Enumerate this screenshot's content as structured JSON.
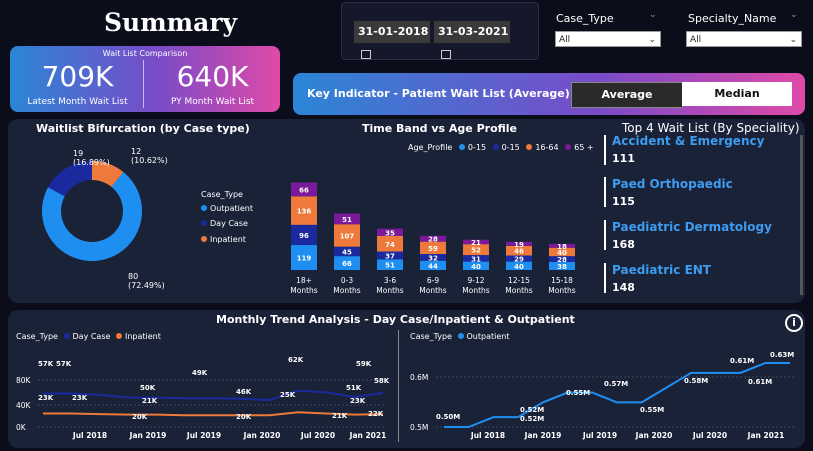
{
  "header": {
    "title": "Summary"
  },
  "dates": {
    "start": "31-01-2018",
    "end": "31-03-2021"
  },
  "slicers": [
    {
      "label": "Case_Type",
      "value": "All"
    },
    {
      "label": "Specialty_Name",
      "value": "All"
    }
  ],
  "wait_card": {
    "title": "Wait List Comparison",
    "latest_value": "709K",
    "latest_label": "Latest Month Wait List",
    "py_value": "640K",
    "py_label": "PY Month Wait List"
  },
  "key_indicator": {
    "label": "Key Indicator - Patient Wait List (Average)",
    "average": "Average",
    "median": "Median"
  },
  "bifurcation": {
    "title": "Waitlist Bifurcation (by Case type)",
    "legend_title": "Case_Type",
    "legend": [
      {
        "name": "Outpatient",
        "color": "#1e8ff0"
      },
      {
        "name": "Day Case",
        "color": "#1a2a9e"
      },
      {
        "name": "Inpatient",
        "color": "#ed7a3a"
      }
    ],
    "labels": [
      {
        "value": "19",
        "pct": "(16.89%)"
      },
      {
        "value": "12",
        "pct": "(10.62%)"
      },
      {
        "value": "80",
        "pct": "(72.49%)"
      }
    ]
  },
  "timeband": {
    "title": "Time Band vs Age Profile",
    "legend_title": "Age_Profile"
  },
  "chart_data": [
    {
      "type": "pie",
      "title": "Waitlist Bifurcation (by Case type)",
      "categories": [
        "Outpatient",
        "Day Case",
        "Inpatient"
      ],
      "values": [
        80,
        19,
        12
      ],
      "percent": [
        72.49,
        16.89,
        10.62
      ],
      "colors": [
        "#1e8ff0",
        "#1a2a9e",
        "#ed7a3a"
      ]
    },
    {
      "type": "bar",
      "stacked": true,
      "title": "Time Band vs Age Profile",
      "legend_title": "Age_Profile",
      "categories": [
        "18+ Months",
        "0-3 Months",
        "3-6 Months",
        "6-9 Months",
        "9-12 Months",
        "12-15 Months",
        "15-18 Months"
      ],
      "series": [
        {
          "name": "0-15",
          "color": "#1e8ff0",
          "values": [
            119,
            66,
            51,
            44,
            40,
            40,
            38
          ]
        },
        {
          "name": "0-15",
          "color": "#1a2a9e",
          "values": [
            96,
            45,
            37,
            32,
            31,
            29,
            28
          ]
        },
        {
          "name": "16-64",
          "color": "#ed7a3a",
          "values": [
            136,
            107,
            74,
            59,
            52,
            46,
            40
          ]
        },
        {
          "name": "65 +",
          "color": "#7a1a9a",
          "values": [
            66,
            51,
            35,
            28,
            21,
            19,
            18
          ]
        }
      ]
    },
    {
      "type": "line",
      "title": "Monthly Trend Analysis - Day Case/Inpatient & Outpatient",
      "legend_title": "Case_Type",
      "x": [
        "Jul 2018",
        "Jan 2019",
        "Jul 2019",
        "Jan 2020",
        "Jul 2020",
        "Jan 2021"
      ],
      "y_ticks": [
        "80K",
        "40K",
        "0K"
      ],
      "series": [
        {
          "name": "Day Case",
          "color": "#1a2a9e",
          "values": [
            57,
            57,
            55,
            50,
            50,
            49,
            49,
            48,
            46,
            62,
            59,
            51,
            58
          ]
        },
        {
          "name": "Inpatient",
          "color": "#ed7a3a",
          "values": [
            23,
            23,
            22,
            21,
            21,
            20,
            20,
            20,
            20,
            25,
            23,
            21,
            22
          ]
        }
      ],
      "point_labels": [
        {
          "series": "Day Case",
          "labels": [
            "57K",
            "57K",
            "50K",
            "49K",
            "46K",
            "62K",
            "51K",
            "59K",
            "58K"
          ]
        },
        {
          "series": "Inpatient",
          "labels": [
            "23K",
            "23K",
            "21K",
            "20K",
            "20K",
            "25K",
            "21K",
            "23K",
            "22K"
          ]
        }
      ]
    },
    {
      "type": "line",
      "title": "Monthly Trend Analysis - Outpatient",
      "legend_title": "Case_Type",
      "x": [
        "Jul 2018",
        "Jan 2019",
        "Jul 2019",
        "Jan 2020",
        "Jul 2020",
        "Jan 2021"
      ],
      "y_ticks": [
        "0.6M",
        "0.5M"
      ],
      "series": [
        {
          "name": "Outpatient",
          "color": "#1e8ff0",
          "values": [
            0.5,
            0.5,
            0.52,
            0.52,
            0.55,
            0.57,
            0.57,
            0.55,
            0.55,
            0.58,
            0.61,
            0.61,
            0.61,
            0.63,
            0.63
          ]
        }
      ],
      "point_labels": [
        {
          "series": "Outpatient",
          "labels": [
            "0.50M",
            "0.52M",
            "0.52M",
            "0.55M",
            "0.57M",
            "0.55M",
            "0.58M",
            "0.61M",
            "0.61M",
            "0.63M"
          ]
        }
      ]
    }
  ],
  "specialities": {
    "title": "Top 4 Wait List (By Speciality)",
    "items": [
      {
        "name": "Accident & Emergency",
        "value": "111"
      },
      {
        "name": "Paed Orthopaedic",
        "value": "115"
      },
      {
        "name": "Paediatric Dermatology",
        "value": "168"
      },
      {
        "name": "Paediatric ENT",
        "value": "148"
      }
    ]
  },
  "trend": {
    "title": "Monthly Trend Analysis - Day Case/Inpatient & Outpatient",
    "left_legend_title": "Case_Type",
    "left_legend": [
      {
        "name": "Day Case",
        "color": "#1a2a9e"
      },
      {
        "name": "Inpatient",
        "color": "#ed7a3a"
      }
    ],
    "right_legend_title": "Case_Type",
    "right_legend": [
      {
        "name": "Outpatient",
        "color": "#1e8ff0"
      }
    ],
    "x_labels": [
      "Jul 2018",
      "Jan 2019",
      "Jul 2019",
      "Jan 2020",
      "Jul 2020",
      "Jan 2021"
    ],
    "left_y": [
      "80K",
      "40K",
      "0K"
    ],
    "right_y": [
      "0.6M",
      "0.5M"
    ],
    "info_icon": "i"
  }
}
